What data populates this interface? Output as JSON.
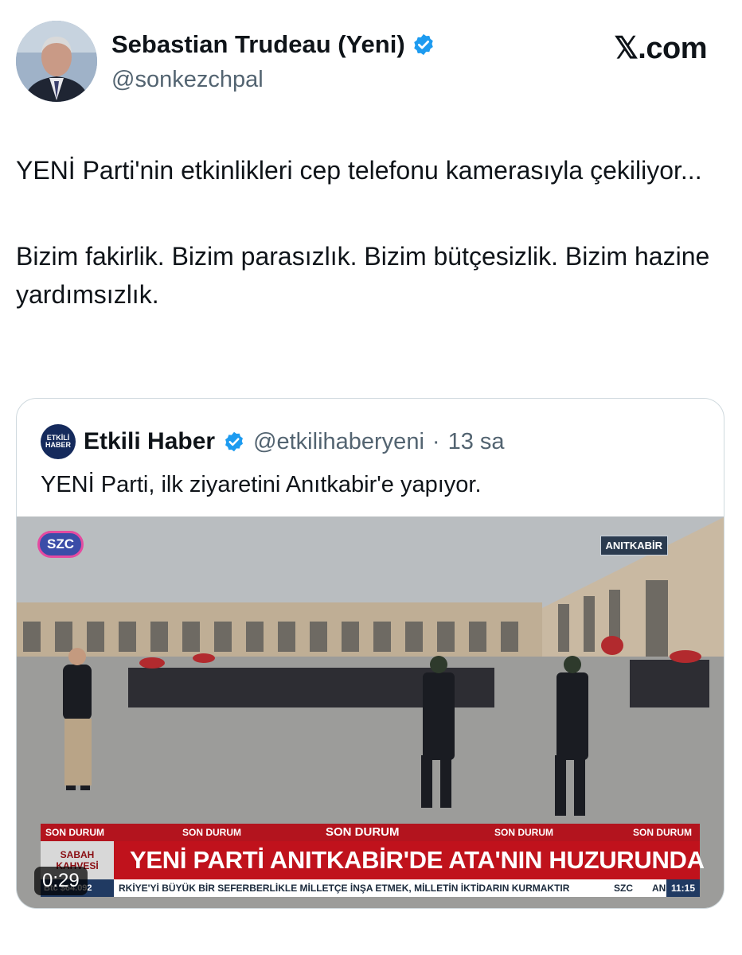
{
  "tweet": {
    "author_name": "Sebastian Trudeau (Yeni)",
    "author_handle": "@sonkezchpal",
    "site_label": "𝕏.com",
    "text_lines": [
      "YENİ Parti'nin etkinlikleri cep telefonu kamerasıyla çekiliyor...",
      "Bizim fakirlik. Bizim parasızlık. Bizim bütçesizlik. Bizim hazine yardımsızlık."
    ]
  },
  "quote": {
    "logo_text": [
      "ETKİLİ",
      "HABER"
    ],
    "name": "Etkili Haber",
    "handle": "@etkilihaberyeni",
    "separator": "·",
    "time": "13 sa",
    "text": "YENİ Parti, ilk ziyaretini Anıtkabir'e yapıyor.",
    "video": {
      "channel_logo": "SZC",
      "location": "ANITKABİR",
      "ticker_labels": [
        "SON DURUM",
        "SON DURUM",
        "SON DURUM",
        "SON DURUM",
        "SON DURUM"
      ],
      "side_label": [
        "SABAH",
        "KAHVESİ"
      ],
      "headline": "YENİ PARTİ ANITKABİR'DE ATA'NIN HUZURUNDA",
      "btc": "Btc $64.092",
      "crawl": "RKİYE'Yİ BÜYÜK BİR SEFERBERLİKLE MİLLETÇE İNŞA ETMEK, MİLLETİN İKTİDARIN KURMAKTIR",
      "crawl_channel": "SZC",
      "crawl_tail": "AN",
      "clock": "11:15",
      "duration": "0:29"
    }
  },
  "colors": {
    "verified": "#1d9bf0",
    "ticker_red": "#c0121c",
    "handle_gray": "#536471"
  },
  "icons": {
    "verified": "verified-badge-icon",
    "x_logo": "x-logo"
  }
}
